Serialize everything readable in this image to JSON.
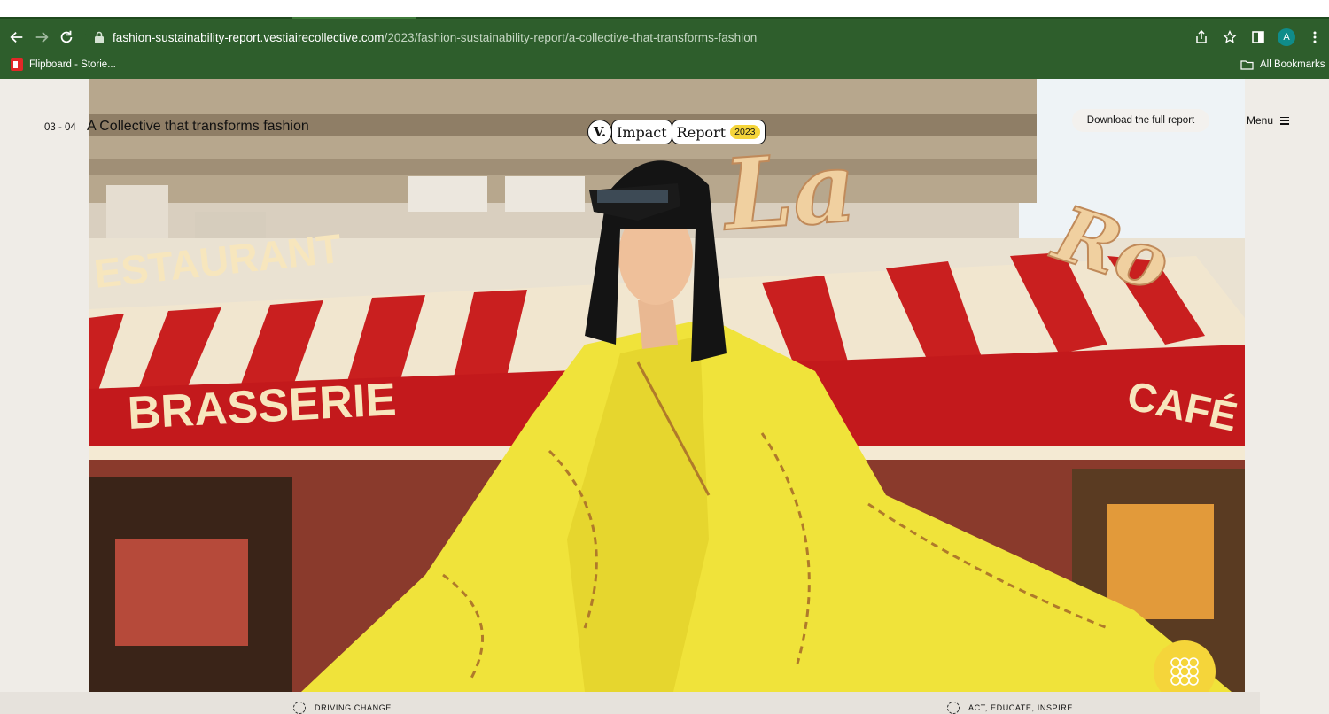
{
  "browser": {
    "url_host": "fashion-sustainability-report.vestiairecollective.com",
    "url_path": "/2023/fashion-sustainability-report/a-collective-that-transforms-fashion",
    "avatar_letter": "A",
    "bookmarks": [
      {
        "label": "Flipboard - Storie...",
        "icon": "flipboard-icon"
      }
    ],
    "all_bookmarks_label": "All Bookmarks",
    "colors": {
      "toolbar": "#2e5e2c",
      "text": "#ffffff"
    }
  },
  "header": {
    "section_number": "03 - 04",
    "section_title": "A Collective that transforms fashion",
    "logo": {
      "mark": "V.",
      "word1": "Impact",
      "word2": "Report",
      "year": "2023"
    },
    "download_label": "Download the full report",
    "menu_label": "Menu"
  },
  "hero": {
    "signs": {
      "restaurant": "ESTAURANT",
      "brasserie": "BRASSERIE",
      "cafe": "CAFÉ",
      "la": "La",
      "ro": "Ro"
    }
  },
  "bottom_nav": [
    {
      "label": "DRIVING CHANGE"
    },
    {
      "label": "ACT, EDUCATE, INSPIRE"
    }
  ],
  "colors": {
    "accent_yellow": "#f5d53a",
    "page_bg": "#efece7"
  }
}
